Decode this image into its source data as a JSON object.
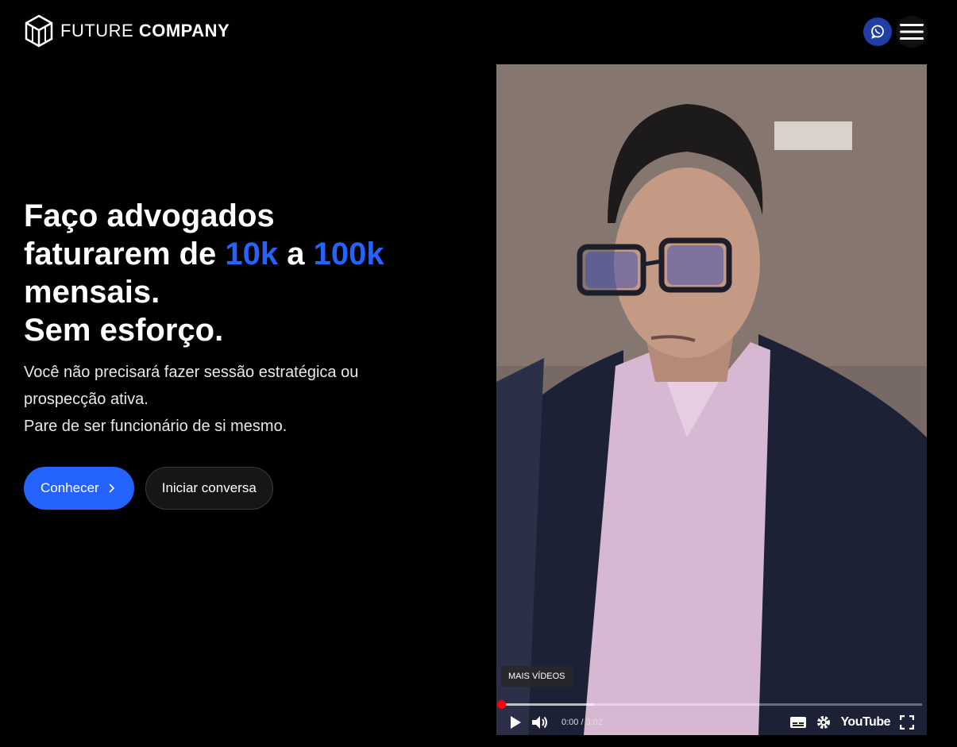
{
  "brand": {
    "name_light": "FUTURE",
    "name_bold": "COMPANY"
  },
  "header": {
    "whatsapp_icon": "whatsapp-icon",
    "menu_icon": "hamburger-menu-icon"
  },
  "hero": {
    "line1": "Faço advogados",
    "line2_pre": "faturarem de ",
    "line2_hl1": "10k",
    "line2_mid": " a ",
    "line2_hl2": "100k",
    "line3": "mensais.",
    "line4": "Sem esforço.",
    "sub1": "Você não precisará fazer sessão estratégica ou prospecção ativa.",
    "sub2": "Pare de ser funcionário de si mesmo.",
    "primary_button": "Conhecer",
    "secondary_button": "Iniciar conversa"
  },
  "colors": {
    "accent": "#2563ff",
    "background": "#000000",
    "whatsapp": "#1f3fa6"
  },
  "video": {
    "more_videos": "MAIS VÍDEOS",
    "time": "0:00 / 3:02",
    "youtube": "YouTube",
    "progress": 0.0
  }
}
